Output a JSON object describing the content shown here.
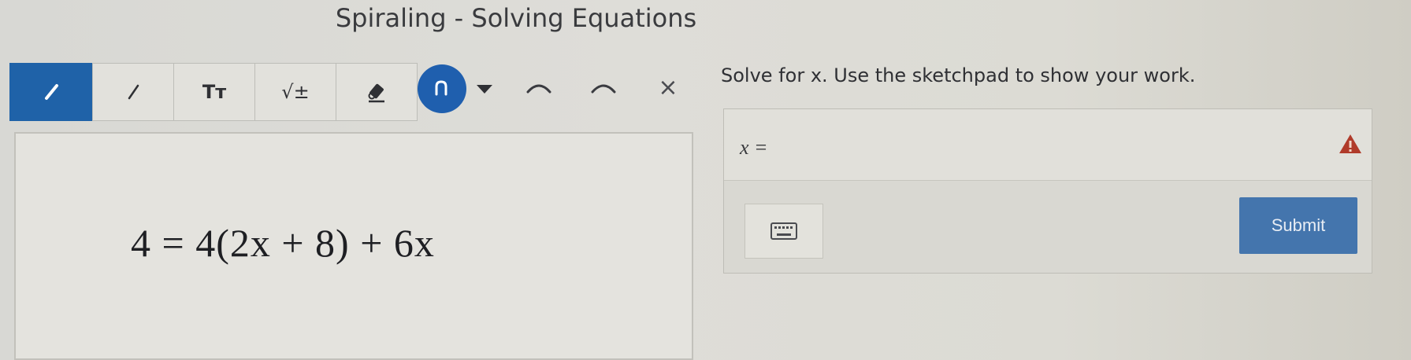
{
  "header": {
    "title": "Spiraling - Solving Equations"
  },
  "toolbar": {
    "tools": [
      {
        "name": "pen",
        "icon": "pen-icon",
        "active": true
      },
      {
        "name": "line",
        "icon": "line-icon",
        "active": false
      },
      {
        "name": "text",
        "label": "Tт",
        "active": false
      },
      {
        "name": "math",
        "label": "√±",
        "active": false
      },
      {
        "name": "eraser",
        "icon": "eraser-icon",
        "active": false
      }
    ],
    "color_picker": {
      "icon": "pen-stroke-icon",
      "color": "#1f5fae"
    },
    "undo_icon": "undo-icon",
    "redo_icon": "redo-icon",
    "clear_label": "×"
  },
  "sketchpad": {
    "equation": "4 = 4(2x + 8) + 6x"
  },
  "question": {
    "prompt": "Solve for x.  Use the sketchpad to show your work.",
    "answer_label": "x =",
    "answer_value": "",
    "warning_icon": "warning-icon",
    "keyboard_icon": "keyboard-icon",
    "submit_label": "Submit"
  },
  "colors": {
    "accent": "#1f62a8",
    "submit": "#4475ad",
    "warning": "#b03b2a"
  }
}
